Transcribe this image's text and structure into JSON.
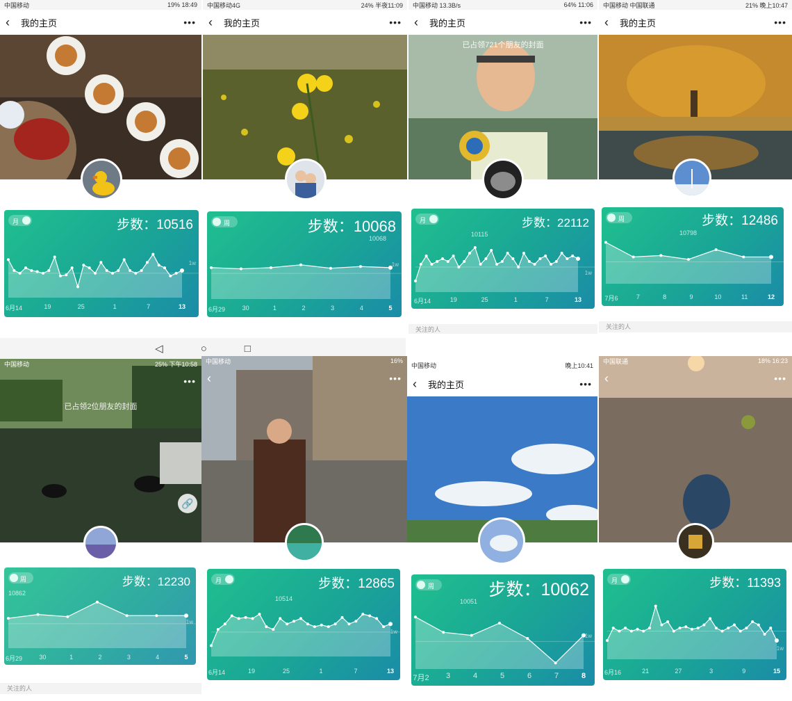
{
  "nav": {
    "title": "我的主页",
    "back": "‹",
    "more": "•••"
  },
  "follow_label": "关注的人",
  "steps_prefix": "步数：",
  "sysnav": {
    "back": "◁",
    "home": "○",
    "recent": "□"
  },
  "tiles": [
    {
      "status_left": "中国移动",
      "status_right": "19% 18:49",
      "cover_text": "",
      "toggle_label": "月",
      "steps": "10516",
      "peak": "",
      "axis": "1w",
      "ticks": [
        "6月14",
        "19",
        "25",
        "1",
        "7",
        "13"
      ],
      "current_tick": 5,
      "colors": {
        "sky": "#6b5846",
        "ground": "#3a2e24"
      }
    },
    {
      "status_left": "中国移动4G",
      "status_right": "24% 半夜11:09",
      "cover_text": "",
      "toggle_label": "周",
      "steps": "10068",
      "peak": "10068",
      "axis": "1w",
      "ticks": [
        "6月29",
        "30",
        "1",
        "2",
        "3",
        "4",
        "5"
      ],
      "current_tick": 6,
      "colors": {
        "sky": "#8a8f63",
        "ground": "#4e5a2a"
      }
    },
    {
      "status_left": "中国移动 13.3B/s",
      "status_right": "64% 11:06",
      "cover_text": "已占领721个朋友的封面",
      "toggle_label": "月",
      "steps": "22112",
      "peak": "10115",
      "axis": "1w",
      "ticks": [
        "6月14",
        "19",
        "25",
        "1",
        "7",
        "13"
      ],
      "current_tick": 5,
      "colors": {
        "sky": "#9cb2a6",
        "ground": "#4a6a55"
      }
    },
    {
      "status_left": "中国移动 中国联通",
      "status_right": "21% 晚上10:47",
      "cover_text": "",
      "toggle_label": "周",
      "steps": "12486",
      "peak": "10798",
      "axis": "",
      "ticks": [
        "7月6",
        "7",
        "8",
        "9",
        "10",
        "11",
        "12"
      ],
      "current_tick": 6,
      "colors": {
        "sky": "#c98a2a",
        "ground": "#3d4a4e"
      }
    },
    {
      "status_left": "中国移动",
      "status_right": "25% 下午10:58",
      "cover_text": "已占领2位朋友的封面",
      "toggle_label": "周",
      "steps": "12230",
      "peak": "10862",
      "axis": "1w",
      "ticks": [
        "6月29",
        "30",
        "1",
        "2",
        "3",
        "4",
        "5"
      ],
      "current_tick": 6,
      "colors": {
        "sky": "#6f8a5a",
        "ground": "#2b3b2c"
      }
    },
    {
      "status_left": "中国移动",
      "status_right": "16%",
      "cover_text": "",
      "toggle_label": "月",
      "steps": "12865",
      "peak": "10514",
      "axis": "1w",
      "ticks": [
        "6月14",
        "19",
        "25",
        "1",
        "7",
        "13"
      ],
      "current_tick": 5,
      "colors": {
        "sky": "#9aa3ad",
        "ground": "#7a736b"
      }
    },
    {
      "status_left": "中国移动",
      "status_right": "晚上10:41",
      "cover_text": "",
      "toggle_label": "周",
      "steps": "10062",
      "peak": "10051",
      "axis": "1w",
      "ticks": [
        "7月2",
        "3",
        "4",
        "5",
        "6",
        "7",
        "8"
      ],
      "current_tick": 6,
      "colors": {
        "sky": "#3a78c4",
        "ground": "#9ec3e8"
      }
    },
    {
      "status_left": "中国联通",
      "status_right": "18% 16:23",
      "cover_text": "",
      "toggle_label": "月",
      "steps": "11393",
      "peak": "",
      "axis": "1w",
      "ticks": [
        "6月16",
        "21",
        "27",
        "3",
        "9",
        "15"
      ],
      "current_tick": 5,
      "colors": {
        "sky": "#b8a592",
        "ground": "#6e6357"
      }
    }
  ],
  "chart_data": [
    {
      "type": "area",
      "title": "步数：10516",
      "series": [
        {
          "values": [
            0.7,
            0.5,
            0.45,
            0.55,
            0.5,
            0.48,
            0.45,
            0.5,
            0.75,
            0.4,
            0.42,
            0.55,
            0.2,
            0.6,
            0.55,
            0.45,
            0.65,
            0.5,
            0.45,
            0.5,
            0.7,
            0.5,
            0.45,
            0.5,
            0.65,
            0.8,
            0.6,
            0.55,
            0.4,
            0.45,
            0.5
          ]
        }
      ]
    },
    {
      "type": "area",
      "title": "步数：10068",
      "series": [
        {
          "values": [
            0.55,
            0.53,
            0.55,
            0.6,
            0.54,
            0.57,
            0.55
          ]
        }
      ]
    },
    {
      "type": "area",
      "title": "步数：22112",
      "series": [
        {
          "values": [
            0.2,
            0.5,
            0.65,
            0.5,
            0.55,
            0.6,
            0.55,
            0.65,
            0.45,
            0.55,
            0.7,
            0.8,
            0.5,
            0.6,
            0.75,
            0.5,
            0.55,
            0.7,
            0.6,
            0.45,
            0.7,
            0.55,
            0.5,
            0.6,
            0.65,
            0.5,
            0.55,
            0.7,
            0.6,
            0.65,
            0.6
          ]
        }
      ]
    },
    {
      "type": "area",
      "title": "步数：12486",
      "series": [
        {
          "values": [
            0.85,
            0.55,
            0.58,
            0.5,
            0.7,
            0.55,
            0.55
          ]
        }
      ]
    },
    {
      "type": "area",
      "title": "步数：12230",
      "series": [
        {
          "values": [
            0.55,
            0.62,
            0.58,
            0.85,
            0.6,
            0.6,
            0.6
          ]
        }
      ]
    },
    {
      "type": "area",
      "title": "步数：12865",
      "series": [
        {
          "values": [
            0.2,
            0.5,
            0.6,
            0.75,
            0.7,
            0.72,
            0.7,
            0.78,
            0.55,
            0.5,
            0.7,
            0.6,
            0.65,
            0.7,
            0.6,
            0.55,
            0.58,
            0.55,
            0.6,
            0.72,
            0.6,
            0.65,
            0.78,
            0.75,
            0.7,
            0.55,
            0.6
          ]
        }
      ]
    },
    {
      "type": "area",
      "title": "步数：10062",
      "series": [
        {
          "values": [
            0.85,
            0.6,
            0.55,
            0.75,
            0.5,
            0.1,
            0.55
          ]
        }
      ]
    },
    {
      "type": "area",
      "title": "步数：11393",
      "series": [
        {
          "values": [
            0.3,
            0.5,
            0.45,
            0.5,
            0.45,
            0.48,
            0.45,
            0.5,
            0.85,
            0.55,
            0.6,
            0.45,
            0.5,
            0.52,
            0.48,
            0.5,
            0.55,
            0.65,
            0.5,
            0.45,
            0.5,
            0.55,
            0.45,
            0.5,
            0.6,
            0.55,
            0.4,
            0.5,
            0.3
          ]
        }
      ]
    }
  ]
}
